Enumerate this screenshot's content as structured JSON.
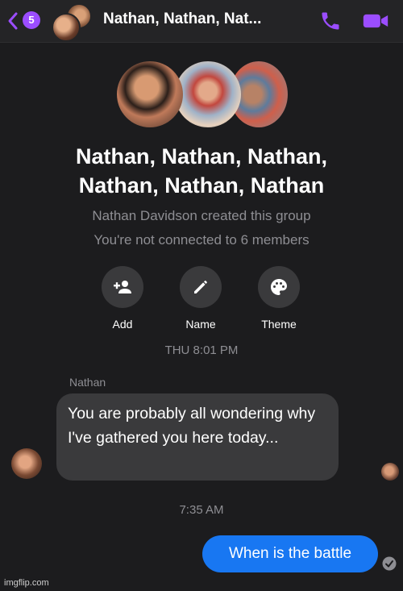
{
  "header": {
    "back_badge": "5",
    "title": "Nathan, Nathan, Nat...",
    "accent_color": "#9b4dff",
    "icons": [
      "back-chevron-icon",
      "phone-icon",
      "video-camera-icon"
    ]
  },
  "group": {
    "name_line1": "Nathan, Nathan, Nathan,",
    "name_line2": "Nathan, Nathan, Nathan",
    "created_by": "Nathan Davidson created this group",
    "connection_note": "You're not connected to 6 members"
  },
  "actions": [
    {
      "label": "Add",
      "icon": "add-person-icon"
    },
    {
      "label": "Name",
      "icon": "pencil-icon"
    },
    {
      "label": "Theme",
      "icon": "palette-icon"
    }
  ],
  "conversation": {
    "timestamp1": "THU 8:01 PM",
    "sender": "Nathan",
    "incoming_message": "You are probably all wondering why I've gathered you here today...",
    "timestamp2": "7:35 AM",
    "outgoing_message": "When is the battle",
    "outgoing_color": "#1877f2"
  },
  "watermark": "imgflip.com"
}
